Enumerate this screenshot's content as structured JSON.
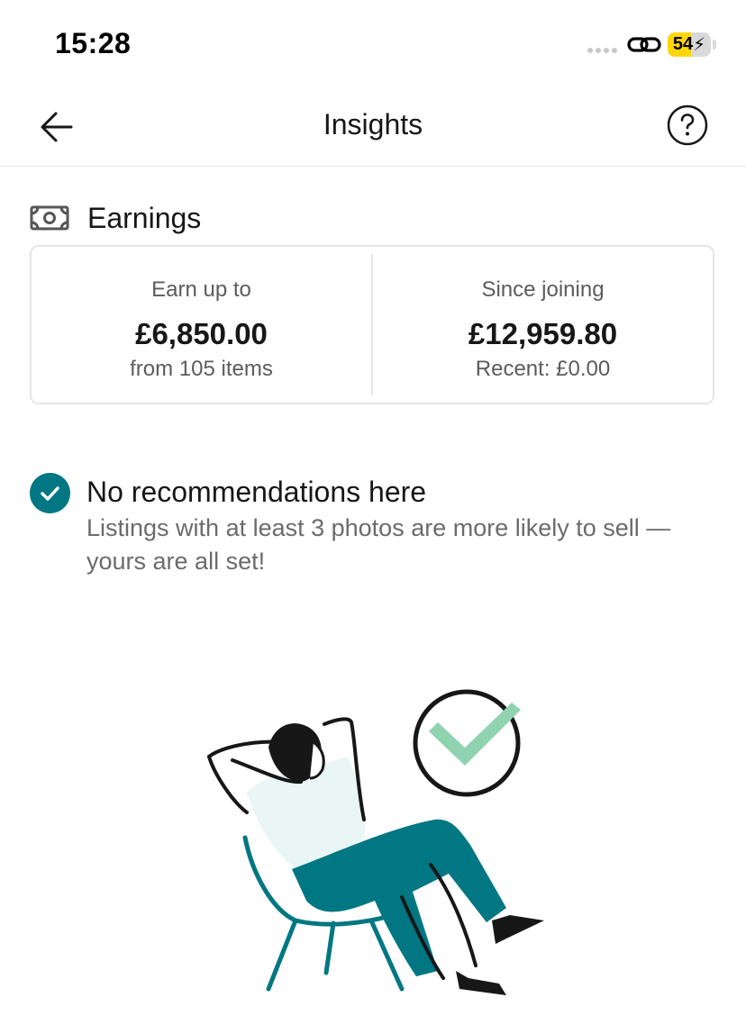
{
  "status_bar": {
    "time": "15:28",
    "battery_level": "54",
    "battery_fill_percent": 54,
    "battery_color": "#ffd60a"
  },
  "nav": {
    "title": "Insights",
    "back_icon": "arrow-left-icon",
    "help_icon": "question-circle-icon"
  },
  "earnings": {
    "icon": "banknote-icon",
    "title": "Earnings",
    "columns": [
      {
        "label": "Earn up to",
        "amount": "£6,850.00",
        "sub": "from 105 items"
      },
      {
        "label": "Since joining",
        "amount": "£12,959.80",
        "sub": "Recent: £0.00"
      }
    ]
  },
  "recommendations": {
    "icon": "check-circle-icon",
    "title": "No recommendations here",
    "body": "Listings with at least 3 photos are more likely to sell — yours are all set!"
  },
  "colors": {
    "accent": "#007782",
    "check_green": "#8fd3b0",
    "illustration_shirt": "#eaf6f6"
  }
}
